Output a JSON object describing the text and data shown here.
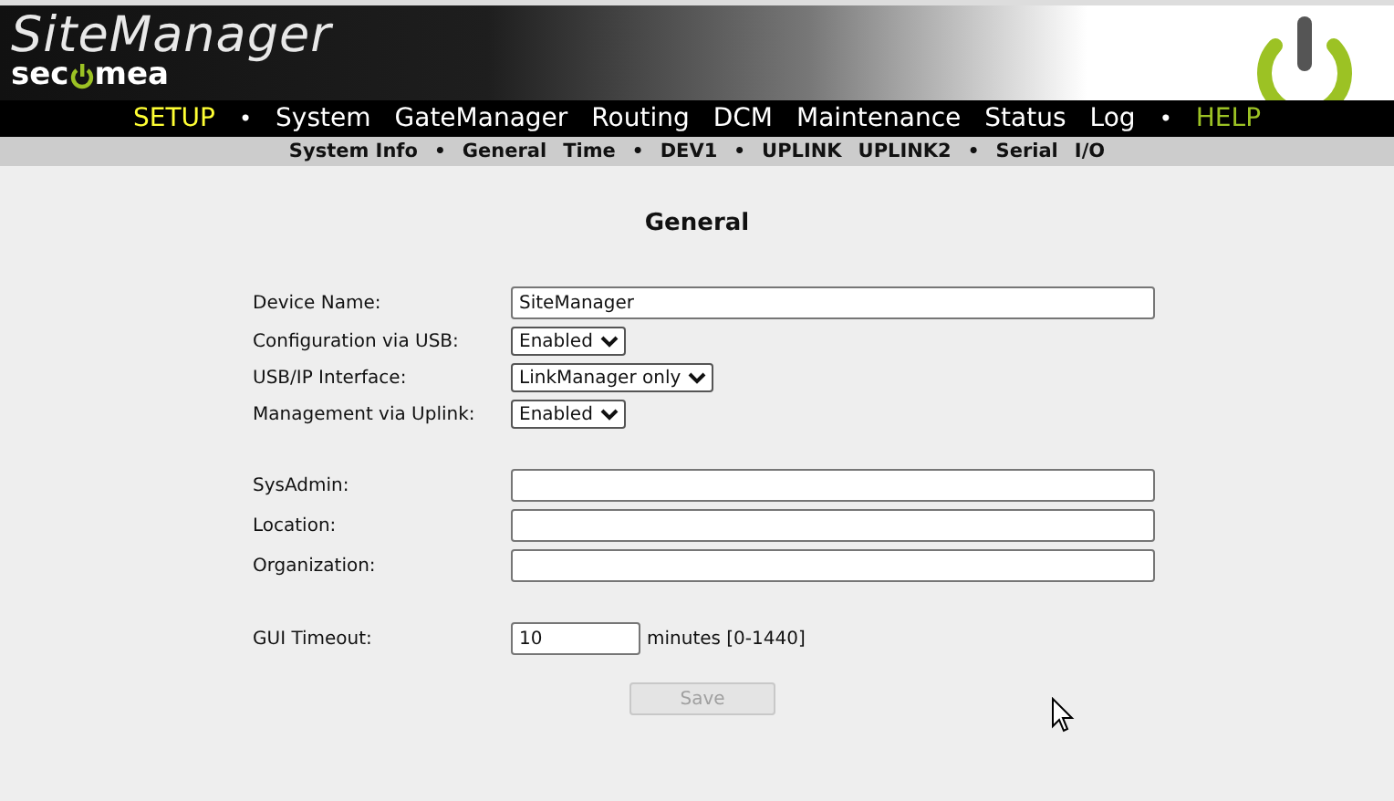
{
  "header": {
    "product": "SiteManager",
    "brand_left": "sec",
    "brand_right": "mea"
  },
  "menu": [
    {
      "kind": "item",
      "label": "SETUP",
      "selected": true
    },
    {
      "kind": "separator",
      "label": "•"
    },
    {
      "kind": "item",
      "label": "System",
      "selected": false
    },
    {
      "kind": "item",
      "label": "GateManager",
      "selected": false
    },
    {
      "kind": "item",
      "label": "Routing",
      "selected": false
    },
    {
      "kind": "item",
      "label": "DCM",
      "selected": false
    },
    {
      "kind": "item",
      "label": "Maintenance",
      "selected": false
    },
    {
      "kind": "item",
      "label": "Status",
      "selected": false
    },
    {
      "kind": "item",
      "label": "Log",
      "selected": false
    },
    {
      "kind": "separator",
      "label": "•"
    },
    {
      "kind": "help",
      "label": "HELP",
      "selected": false
    }
  ],
  "submenu": [
    {
      "kind": "item",
      "label": "System Info"
    },
    {
      "kind": "separator",
      "label": "•"
    },
    {
      "kind": "item",
      "label": "General"
    },
    {
      "kind": "item",
      "label": "Time"
    },
    {
      "kind": "separator",
      "label": "•"
    },
    {
      "kind": "item",
      "label": "DEV1"
    },
    {
      "kind": "separator",
      "label": "•"
    },
    {
      "kind": "item",
      "label": "UPLINK"
    },
    {
      "kind": "item",
      "label": "UPLINK2"
    },
    {
      "kind": "separator",
      "label": "•"
    },
    {
      "kind": "item",
      "label": "Serial"
    },
    {
      "kind": "item",
      "label": "I/O"
    }
  ],
  "form": {
    "title": "General",
    "rows": [
      {
        "kind": "text",
        "label": "Device Name:",
        "value": "SiteManager"
      },
      {
        "kind": "select",
        "label": "Configuration via USB:",
        "value": "Enabled"
      },
      {
        "kind": "select",
        "label": "USB/IP Interface:",
        "value": "LinkManager only"
      },
      {
        "kind": "select",
        "label": "Management via Uplink:",
        "value": "Enabled"
      },
      {
        "kind": "spacer"
      },
      {
        "kind": "text",
        "label": "SysAdmin:"
      },
      {
        "kind": "text",
        "label": "Location:"
      },
      {
        "kind": "text",
        "label": "Organization:"
      },
      {
        "kind": "spacer"
      },
      {
        "kind": "short",
        "label": "GUI Timeout:",
        "value": "10",
        "suffix": "minutes [0-1440]"
      }
    ],
    "save": {
      "label": "Save",
      "disabled": true
    }
  }
}
